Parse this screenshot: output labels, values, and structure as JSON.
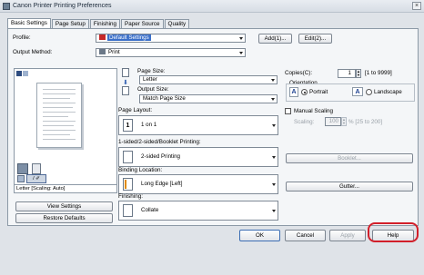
{
  "window": {
    "title": "Canon Printer Printing Preferences"
  },
  "tabs": [
    "Basic Settings",
    "Page Setup",
    "Finishing",
    "Paper Source",
    "Quality"
  ],
  "profile": {
    "label": "Profile:",
    "value": "Default Settings",
    "add_label": "Add(1)...",
    "edit_label": "Edit(2)..."
  },
  "output": {
    "label": "Output Method:",
    "value": "Print"
  },
  "preview": {
    "caption": "Letter [Scaling: Auto]",
    "view_settings": "View Settings",
    "restore_defaults": "Restore Defaults"
  },
  "page_size": {
    "label": "Page Size:",
    "value": "Letter"
  },
  "output_size": {
    "label": "Output Size:",
    "value": "Match Page Size"
  },
  "copies": {
    "label": "Copies(C):",
    "value": "1",
    "range": "[1 to 9999]"
  },
  "orientation": {
    "label": "Orientation",
    "portrait": "Portrait",
    "landscape": "Landscape",
    "selected": "portrait"
  },
  "page_layout": {
    "label": "Page Layout:",
    "value": "1 on 1"
  },
  "manual_scaling": {
    "label": "Manual Scaling",
    "scaling_label": "Scaling:",
    "value": "100",
    "range": "% [25 to 200]"
  },
  "duplex": {
    "label": "1-sided/2-sided/Booklet Printing:",
    "value": "2-sided Printing",
    "booklet_label": "Booklet..."
  },
  "binding": {
    "label": "Binding Location:",
    "value": "Long Edge [Left]",
    "gutter_label": "Gutter..."
  },
  "finishing": {
    "label": "Finishing:",
    "value": "Collate"
  },
  "footer": {
    "ok": "OK",
    "cancel": "Cancel",
    "apply": "Apply",
    "help": "Help"
  }
}
